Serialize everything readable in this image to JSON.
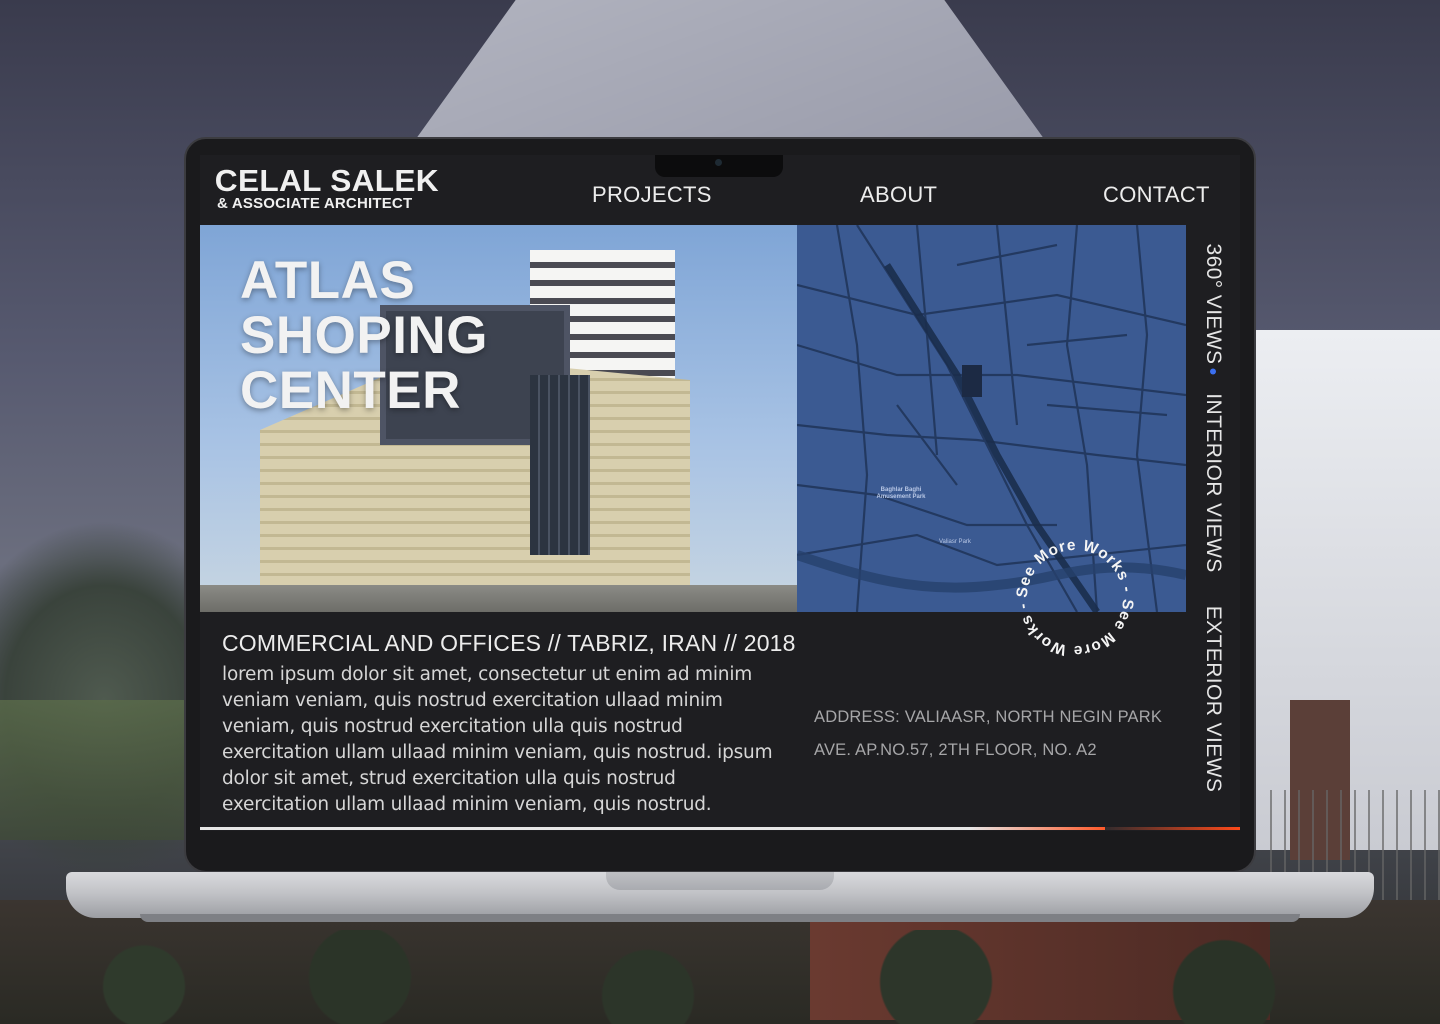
{
  "brand": {
    "name": "CELAL SALEK",
    "subtitle": "& ASSOCIATE ARCHITECT"
  },
  "nav": {
    "projects": "PROJECTS",
    "about": "ABOUT",
    "contact": "CONTACT"
  },
  "hero": {
    "title_line1": "ATLAS",
    "title_line2": "SHOPING",
    "title_line3": "CENTER"
  },
  "side_tabs": {
    "views_360": "360° VIEWS",
    "interior": "INTERIOR VIEWS",
    "exterior": "EXTERIOR VIEWS"
  },
  "project": {
    "category": "COMMERCIAL AND OFFICES  //  TABRIZ, IRAN  //  2018",
    "description": "lorem ipsum dolor sit amet, consectetur  ut enim ad minim veniam veniam, quis nostrud exercitation ullaad minim veniam, quis nostrud exercitation ulla quis nostrud exercitation ullam ullaad minim veniam, quis nostrud. ipsum dolor sit amet, strud exercitation ulla quis nostrud exercitation ullam ullaad minim veniam, quis nostrud.",
    "address_line1": "ADDRESS: VALIAASR, NORTH NEGIN PARK",
    "address_line2": "AVE. AP.NO.57, 2TH FLOOR, NO. A2"
  },
  "see_more": {
    "label": "See More Works - See More Works - "
  },
  "map": {
    "park_label": "Baghlar Baghi Amusement Park",
    "park2_label": "Valiasr Park"
  },
  "progress": {
    "fraction": 0.87
  },
  "colors": {
    "accent": "#ff4a1a",
    "map_blue": "#3b5a92",
    "screen_bg": "#1e1e21"
  }
}
